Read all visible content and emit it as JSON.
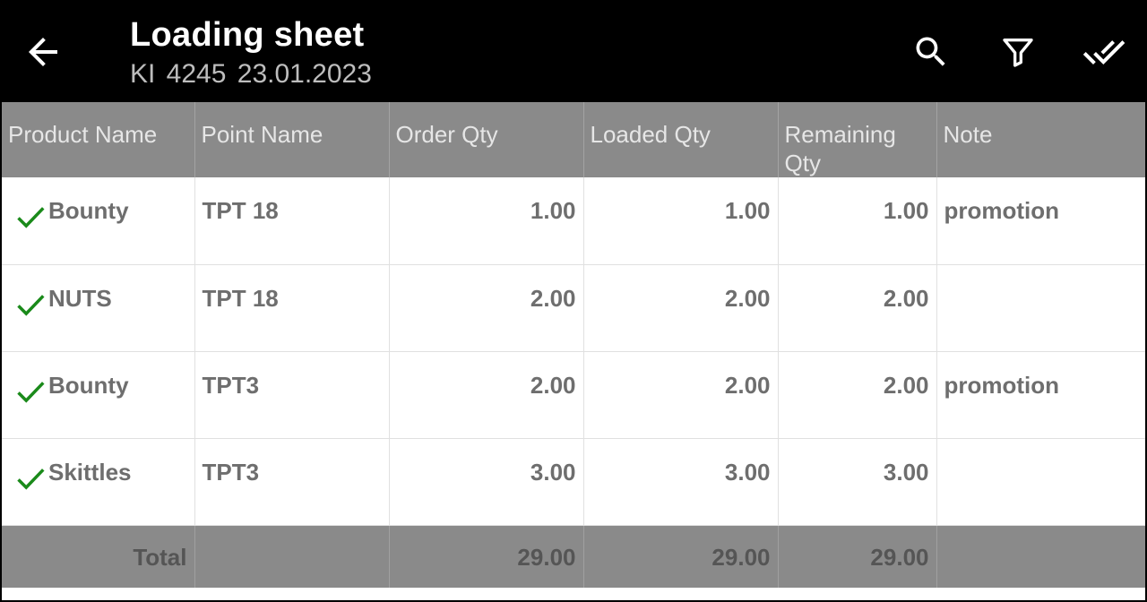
{
  "header": {
    "title": "Loading sheet",
    "subtitle": "KI 4245  23.01.2023",
    "icons": {
      "back": "arrow-back-icon",
      "search": "search-icon",
      "filter": "filter-icon",
      "confirm": "done-all-icon"
    }
  },
  "table": {
    "columns": [
      "Product Name",
      "Point Name",
      "Order Qty",
      "Loaded Qty",
      "Remaining Qty",
      "Note"
    ],
    "rows": [
      {
        "checked": true,
        "product": "Bounty",
        "point": "TPT 18",
        "order": "1.00",
        "loaded": "1.00",
        "remaining": "1.00",
        "note": "promotion"
      },
      {
        "checked": true,
        "product": "NUTS",
        "point": "TPT 18",
        "order": "2.00",
        "loaded": "2.00",
        "remaining": "2.00",
        "note": ""
      },
      {
        "checked": true,
        "product": "Bounty",
        "point": "TPT3",
        "order": "2.00",
        "loaded": "2.00",
        "remaining": "2.00",
        "note": "promotion"
      },
      {
        "checked": true,
        "product": "Skittles",
        "point": "TPT3",
        "order": "3.00",
        "loaded": "3.00",
        "remaining": "3.00",
        "note": ""
      }
    ],
    "totals": {
      "label": "Total",
      "order": "29.00",
      "loaded": "29.00",
      "remaining": "29.00"
    }
  },
  "colors": {
    "app_bar": "#000000",
    "header_bg": "#8a8a8a",
    "check": "#1a8a1a",
    "cell_text": "#6e6e6e"
  }
}
